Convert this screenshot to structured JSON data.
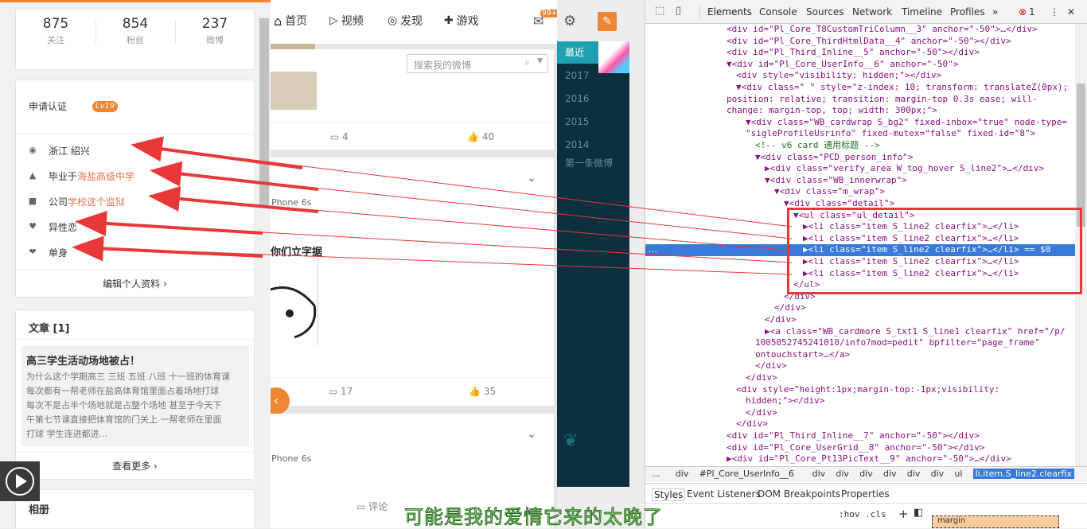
{
  "profile": {
    "stats": [
      {
        "num": "875",
        "label": "关注"
      },
      {
        "num": "854",
        "label": "粉丝"
      },
      {
        "num": "237",
        "label": "微博"
      }
    ],
    "verify_label": "申请认证",
    "level": "Lv19",
    "details": [
      {
        "prefix": "浙江 绍兴",
        "link": ""
      },
      {
        "prefix": "毕业于 ",
        "link": "海盐高级中学"
      },
      {
        "prefix": "公司 ",
        "link": "学校这个监狱"
      },
      {
        "prefix": "异性恋",
        "link": ""
      },
      {
        "prefix": "单身",
        "link": ""
      }
    ],
    "edit_label": "编辑个人资料",
    "articles_title": "文章 [1]",
    "article": {
      "title": "高三学生活动场地被占！",
      "body": [
        "为什么这个学期高三 三班 五班 八班 十一班的体育课",
        "每次都有一帮老师在盐高体育馆里面占着场地打球",
        "每次不是占半个场地就是占整个场地 甚至于今天下",
        "午第七节课直接把体育馆的门关上 一帮老师在里面",
        "打球 学生连进都进..."
      ]
    },
    "see_more": "查看更多",
    "album_title": "相册"
  },
  "feed": {
    "nav": [
      "首页",
      "视频",
      "发现",
      "游戏"
    ],
    "badge": "99+",
    "search_placeholder": "搜索我的微博",
    "post1": {
      "comments": "4",
      "likes": "40"
    },
    "post2": {
      "source": "Phone 6s",
      "text": "你们立字据",
      "comments": "17",
      "likes": "35"
    },
    "post3": {
      "source": "Phone 6s",
      "comment_label": "评论"
    }
  },
  "timeline": {
    "recent": "最近",
    "years": [
      "2017",
      "2016",
      "2015",
      "2014"
    ],
    "first": "第一条微博"
  },
  "devtools": {
    "tabs": [
      "Elements",
      "Console",
      "Sources",
      "Network",
      "Timeline",
      "Profiles"
    ],
    "errors": "1",
    "lines": [
      "<div id=\"Pl_Core_T8CustomTriColumn__3\" anchor=\"-50\">…</div>",
      "<div id=\"Pl_Core_ThirdHtmlData__4\" anchor=\"-50\"></div>",
      "<div id=\"Pl_Third_Inline__5\" anchor=\"-50\"></div>",
      "▼<div id=\"Pl_Core_UserInfo__6\" anchor=\"-50\">",
      "<div style=\"visibility: hidden;\"></div>",
      "▼<div class=\" \" style=\"z-index: 10; transform: translateZ(0px);",
      "position: relative; transition: margin-top 0.3s ease; will-",
      "change: margin-top, top; width: 300px;\">",
      "▼<div class=\"WB_cardwrap S_bg2\" fixed-inbox=\"true\" node-type=",
      "\"sigleProfileUsrinfo\" fixed-mutex=\"false\" fixed-id=\"8\">",
      "<!-- v6 card 通用标题 -->",
      "▼<div class=\"PCD_person_info\">",
      "▶<div class=\"verify_area W_tog_hover S_line2\">…</div>",
      "▼<div class=\"WB_innerwrap\">",
      "▼<div class=\"m_wrap\">",
      "▼<div class=\"detail\">",
      "▼<ul class=\"ul_detail\">",
      "▶<li class=\"item S_line2 clearfix\">…</li>",
      "▶<li class=\"item S_line2 clearfix\">…</li>",
      "▶<li class=\"item S_line2 clearfix\">…</li> == $0",
      "▶<li class=\"item S_line2 clearfix\">…</li>",
      "▶<li class=\"item S_line2 clearfix\">…</li>",
      "</ul>",
      "</div>",
      "</div>",
      "</div>",
      "▶<a class=\"WB_cardmore S_txt1 S_line1 clearfix\" href=\"/p/",
      "1005052745241010/info?mod=pedit\" bpfilter=\"page_frame\"",
      "ontouchstart>…</a>",
      "</div>",
      "</div>",
      "<div style=\"height:1px;margin-top:-1px;visibility:",
      "hidden;\"></div>",
      "</div>",
      "</div>",
      "<div id=\"Pl_Third_Inline__7\" anchor=\"-50\"></div>",
      "<div id=\"Pl_Core_UserGrid__8\" anchor=\"-50\"></div>",
      "▶<div id=\"Pl_Core_Pt13PicText__9\" anchor=\"-50\">…</div>"
    ],
    "crumbs": [
      "...",
      "div",
      "#Pl_Core_UserInfo__6",
      "div",
      "div",
      "div",
      "div",
      "div",
      "div",
      "ul",
      "li.item.S_line2.clearfix"
    ],
    "style_tabs": [
      "Styles",
      "Event Listeners",
      "DOM Breakpoints",
      "Properties"
    ],
    "filter": ":hov  .cls",
    "box_label": "margin"
  },
  "subtitle": "可能是我的爱情它来的太晚了"
}
